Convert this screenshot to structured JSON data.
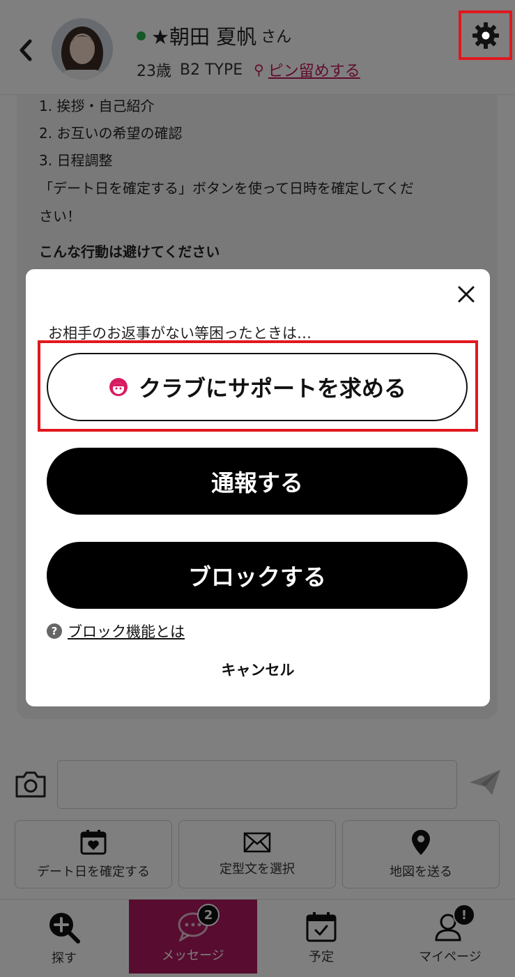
{
  "header": {
    "name": "★朝田 夏帆",
    "honorific": "さん",
    "age": "23歳",
    "type": "B2 TYPE",
    "pin_label": "ピン留めする"
  },
  "chat": {
    "lines": [
      "1. 挨拶・自己紹介",
      "2. お互いの希望の確認",
      "3. 日程調整",
      "「デート日を確定する」ボタンを使って日時を確定してくだ",
      "さい！",
      "こんな行動は避けてください"
    ]
  },
  "actions": {
    "date_label": "デート日を確定する",
    "template_label": "定型文を選択",
    "map_label": "地図を送る"
  },
  "nav": {
    "search_label": "探す",
    "message_label": "メッセージ",
    "message_badge": "2",
    "schedule_label": "予定",
    "mypage_label": "マイページ",
    "mypage_badge": "!"
  },
  "modal": {
    "lead": "お相手のお返事がない等困ったときは…",
    "support_label": "クラブにサポートを求める",
    "report_label": "通報する",
    "block_label": "ブロックする",
    "help_icon_text": "?",
    "help_link": "ブロック機能とは",
    "cancel_label": "キャンセル"
  },
  "colors": {
    "accent": "#b0185e",
    "highlight_border": "#e0181e",
    "online": "#2bb24c"
  }
}
